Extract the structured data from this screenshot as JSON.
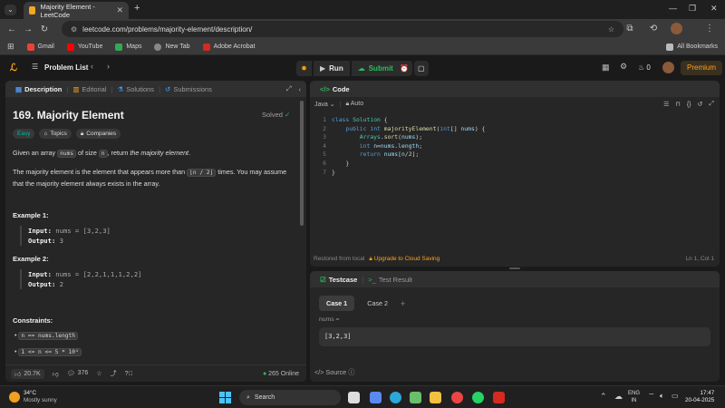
{
  "browser": {
    "tab_title": "Majority Element - LeetCode",
    "url": "leetcode.com/problems/majority-element/description/",
    "bookmarks": [
      "Gmail",
      "YouTube",
      "Maps",
      "New Tab",
      "Adobe Acrobat"
    ],
    "all_bookmarks": "All Bookmarks"
  },
  "header": {
    "problem_list": "Problem List",
    "run": "Run",
    "submit": "Submit",
    "streak": "0",
    "premium": "Premium"
  },
  "description_panel": {
    "tabs": [
      "Description",
      "Editorial",
      "Solutions",
      "Submissions"
    ],
    "title": "169. Majority Element",
    "status": "Solved",
    "chips": [
      "Easy",
      "Topics",
      "Companies"
    ],
    "para1_a": "Given an array",
    "para1_code1": "nums",
    "para1_b": "of size",
    "para1_code2": "n",
    "para1_c": ", return",
    "para1_em": "the majority element",
    "para1_d": ".",
    "para2_a": "The majority element is the element that appears more than",
    "para2_code": "⌊n / 2⌋",
    "para2_b": "times. You may assume that the majority element always exists in the array.",
    "example1_title": "Example 1:",
    "example1_input_label": "Input:",
    "example1_input": "nums = [3,2,3]",
    "example1_output_label": "Output:",
    "example1_output": "3",
    "example2_title": "Example 2:",
    "example2_input_label": "Input:",
    "example2_input": "nums = [2,2,1,1,1,2,2]",
    "example2_output_label": "Output:",
    "example2_output": "2",
    "constraints_title": "Constraints:",
    "constraint1": "n == nums.length",
    "constraint2": "1 <= n <= 5 * 10⁴",
    "likes": "20.7K",
    "comments": "376",
    "online": "265 Online"
  },
  "code_panel": {
    "title": "Code",
    "language": "Java",
    "auto": "Auto",
    "lines": [
      "class Solution {",
      "    public int majorityElement(int[] nums) {",
      "        Arrays.sort(nums);",
      "        int n=nums.length;",
      "        return nums[n/2];",
      "    }",
      "}"
    ],
    "line_numbers": [
      "1",
      "2",
      "3",
      "4",
      "5",
      "6",
      "7"
    ],
    "restored": "Restored from local",
    "upgrade": "Upgrade to Cloud Saving",
    "cursor": "Ln 1, Col 1"
  },
  "testcase_panel": {
    "tab_testcase": "Testcase",
    "tab_result": "Test Result",
    "case1": "Case 1",
    "case2": "Case 2",
    "add": "+",
    "input_label": "nums =",
    "input_value": "[3,2,3]",
    "source": "Source"
  },
  "taskbar": {
    "temp": "34°C",
    "weather": "Mostly sunny",
    "search": "Search",
    "lang1": "ENG",
    "lang2": "IN",
    "time": "17:47",
    "date": "20-04-2025"
  },
  "colors": {
    "accent_orange": "#ffa116",
    "easy_teal": "#00b8a3",
    "solved_green": "#2cbb5d",
    "keyword_blue": "#569cd6",
    "type_teal": "#4ec9b0",
    "method_yellow": "#dcdcaa"
  }
}
